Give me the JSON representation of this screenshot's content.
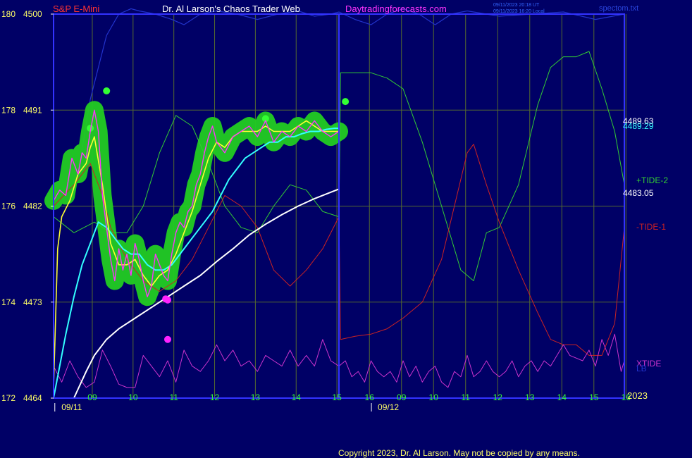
{
  "header": {
    "instrument": "S&P E-Mini",
    "author": "Dr. Al Larson's Chaos Trader Web",
    "site": "Daytradingforecasts.com",
    "stamp_line1": "09/11/2023 20:18 UT",
    "stamp_line2": "09/11/2023 16:20 Local",
    "file": "spectom.txt"
  },
  "footer": {
    "copyright": "Copyright 2023, Dr. Al Larson. May not be copied by any means.",
    "year": "2023"
  },
  "colors": {
    "background": "#000066",
    "frame": "#3333ff",
    "grid": "#556b2f",
    "price": "#ff33ff",
    "fast_ma": "#ffff33",
    "medium_ma": "#33ffff",
    "slow_ma": "#ffffff",
    "tide_plus2": "#33cc33",
    "tide_minus1": "#cc2222",
    "xtide": "#cc33cc",
    "blue_line": "#2233cc",
    "halo": "#22cc22",
    "halo_dot": "#33ff33",
    "dot": "#ff22ff"
  },
  "chart_data": {
    "type": "line",
    "y_axis_left": {
      "ticks": [
        {
          "outer": "172",
          "inner": "4464",
          "value": 4464
        },
        {
          "outer": "174",
          "inner": "4473",
          "value": 4473
        },
        {
          "outer": "176",
          "inner": "4482",
          "value": 4482
        },
        {
          "outer": "178",
          "inner": "4491",
          "value": 4491
        },
        {
          "outer": "180",
          "inner": "4500",
          "value": 4500
        }
      ],
      "ylim": [
        4464,
        4500
      ]
    },
    "x_axis": {
      "hours": [
        "09",
        "10",
        "11",
        "12",
        "13",
        "14",
        "15",
        "16",
        "09",
        "10",
        "11",
        "12",
        "13",
        "14",
        "15",
        "16"
      ],
      "dates": [
        {
          "label": "09/11",
          "after_hour_index": 0
        },
        {
          "label": "09/12",
          "after_hour_index": 8
        }
      ]
    },
    "right_labels": {
      "values": [
        {
          "text": "4489.63",
          "value": 4489.63,
          "color": "#ffffff"
        },
        {
          "text": "4489.29",
          "value": 4489.29,
          "color": "#33ffff"
        },
        {
          "text": "4483.05",
          "value": 4483.05,
          "color": "#ffffff"
        }
      ],
      "series": [
        {
          "text": "+TIDE-2",
          "color": "#33cc33"
        },
        {
          "text": "-TIDE-1",
          "color": "#cc2222"
        },
        {
          "text": "XTIDE",
          "color": "#cc33cc"
        },
        {
          "text": "LB",
          "color": "#2233cc"
        }
      ]
    },
    "series": [
      {
        "key": "price",
        "x": [
          0,
          0.15,
          0.3,
          0.45,
          0.6,
          0.7,
          0.8,
          0.9,
          1.0,
          1.1,
          1.2,
          1.3,
          1.4,
          1.5,
          1.6,
          1.7,
          1.8,
          1.9,
          2.0,
          2.1,
          2.2,
          2.3,
          2.4,
          2.5,
          2.6,
          2.7,
          2.8,
          2.9,
          3.0,
          3.1,
          3.2,
          3.3,
          3.4,
          3.5,
          3.6,
          3.7,
          3.8,
          3.9,
          4.0,
          4.2,
          4.4,
          4.6,
          4.8,
          5.0,
          5.2,
          5.4,
          5.6,
          5.8,
          6.0,
          6.2,
          6.4,
          6.6,
          6.8,
          7.0
        ],
        "y": [
          4482.5,
          4483.5,
          4483,
          4486.5,
          4485,
          4487,
          4486.5,
          4489,
          4491,
          4489,
          4483,
          4480,
          4477,
          4475,
          4478,
          4476,
          4477.5,
          4475.5,
          4478.5,
          4477,
          4475,
          4473.5,
          4474.5,
          4477.5,
          4476.5,
          4475.5,
          4475,
          4477.5,
          4479.5,
          4480.5,
          4480,
          4481.5,
          4482,
          4484,
          4485,
          4487,
          4488.5,
          4489.5,
          4488,
          4487,
          4488.5,
          4489,
          4489.5,
          4488.5,
          4490,
          4488,
          4489,
          4488.5,
          4489.5,
          4489,
          4490,
          4489,
          4488.5,
          4489
        ]
      },
      {
        "key": "fast_ma",
        "x": [
          0,
          0.1,
          0.2,
          0.4,
          0.6,
          0.8,
          0.9,
          1.0,
          1.2,
          1.4,
          1.6,
          1.8,
          2.0,
          2.2,
          2.4,
          2.6,
          2.8,
          3.0,
          3.2,
          3.4,
          3.6,
          3.8,
          4.0,
          4.2,
          4.4,
          4.6,
          4.8,
          5.0,
          5.2,
          5.4,
          5.6,
          5.8,
          6.0,
          6.2,
          6.4,
          6.6,
          6.8,
          7.0
        ],
        "y": [
          4465,
          4478,
          4481,
          4482.5,
          4485,
          4486,
          4487.5,
          4488.5,
          4484,
          4478.5,
          4476.5,
          4476.5,
          4477,
          4475.5,
          4474.5,
          4475.5,
          4476,
          4477.5,
          4479.5,
          4481.5,
          4484,
          4486.5,
          4488,
          4487.5,
          4488.5,
          4489,
          4489,
          4489,
          4489.5,
          4489,
          4489,
          4489,
          4489.5,
          4490,
          4489.5,
          4489,
          4489,
          4489
        ]
      },
      {
        "key": "medium_ma",
        "x": [
          0,
          0.15,
          0.3,
          0.5,
          0.7,
          0.9,
          1.1,
          1.3,
          1.5,
          1.7,
          1.9,
          2.1,
          2.3,
          2.5,
          2.7,
          2.9,
          3.1,
          3.3,
          3.5,
          3.7,
          3.9,
          4.1,
          4.3,
          4.5,
          4.7,
          4.9,
          5.1,
          5.3,
          5.5,
          5.7,
          5.9,
          6.1,
          6.3,
          6.5,
          6.7,
          6.9,
          7.0
        ],
        "y": [
          4464,
          4467,
          4470,
          4473.5,
          4476.5,
          4478.5,
          4480.5,
          4480,
          4479,
          4478,
          4477.5,
          4477.5,
          4476.5,
          4476,
          4476,
          4476.5,
          4477.5,
          4478.5,
          4479.5,
          4480.5,
          4481.5,
          4483,
          4484.5,
          4485.5,
          4486.5,
          4487,
          4487.5,
          4488,
          4488,
          4488.5,
          4488.5,
          4488.8,
          4489,
          4489,
          4489.2,
          4489.3,
          4489.29
        ]
      },
      {
        "key": "slow_ma",
        "x": [
          0.5,
          0.8,
          1.0,
          1.3,
          1.6,
          2.0,
          2.4,
          2.8,
          3.2,
          3.6,
          4.0,
          4.4,
          4.8,
          5.2,
          5.6,
          6.0,
          6.4,
          6.8,
          7.0
        ],
        "y": [
          4464,
          4466.5,
          4468,
          4469.5,
          4470.5,
          4471.5,
          4472.5,
          4473.5,
          4474.5,
          4475.5,
          4476.8,
          4478,
          4479.3,
          4480.3,
          4481.2,
          4482,
          4482.7,
          4483.3,
          4483.6
        ]
      },
      {
        "key": "tide_plus2",
        "x": [
          0,
          0.5,
          1.0,
          1.4,
          1.8,
          2.2,
          2.6,
          3.0,
          3.4,
          3.8,
          4.2,
          4.6,
          5.0,
          5.4,
          5.8,
          6.2,
          6.6,
          7.0,
          7.05,
          7.3,
          7.6,
          8.0,
          8.5,
          9.0,
          9.6,
          10.2,
          10.8,
          11.2,
          11.6,
          12.0,
          12.6,
          13.2,
          13.6,
          14.0,
          14.4,
          14.8,
          15.2,
          15.6,
          15.9
        ],
        "y": [
          4481,
          4479.5,
          4480.5,
          4479.5,
          4479.5,
          4482,
          4487,
          4490.5,
          4489.5,
          4486,
          4482,
          4480,
          4479.5,
          4482,
          4484,
          4483.5,
          4481.5,
          4481,
          4494.5,
          4494.5,
          4494.5,
          4494.5,
          4494,
          4493,
          4488,
          4482,
          4476,
          4475,
          4479.5,
          4480,
          4484,
          4491.5,
          4495,
          4496,
          4496,
          4496.5,
          4493,
          4489,
          4484
        ]
      },
      {
        "key": "tide_minus1",
        "x": [
          0,
          0.5,
          0.9,
          1.2,
          1.4,
          1.8,
          2.2,
          2.6,
          3.0,
          3.4,
          3.8,
          4.2,
          4.6,
          5.0,
          5.4,
          5.8,
          6.2,
          6.6,
          7.0,
          7.05,
          7.5,
          8.0,
          8.5,
          9.0,
          9.6,
          10.2,
          10.6,
          11.0,
          11.2,
          11.6,
          12.0,
          12.6,
          13.2,
          13.6,
          14.0,
          14.4,
          14.8,
          15.2,
          15.6,
          15.9
        ],
        "y": [
          4482,
          4484,
          4486,
          4483,
          4480,
          4477,
          4475,
          4474,
          4475,
          4477,
          4480,
          4483,
          4482,
          4480,
          4476,
          4474.5,
          4476,
          4478,
          4481,
          4469.5,
          4469.8,
          4470,
          4470.5,
          4471.5,
          4473,
          4477,
          4482,
          4487,
          4487.8,
          4484,
          4480.5,
          4476,
          4472,
          4469.5,
          4469,
          4469,
          4468,
          4468,
          4471,
          4480
        ]
      },
      {
        "key": "xtide",
        "x": [
          0,
          0.2,
          0.4,
          0.6,
          0.8,
          1.0,
          1.2,
          1.4,
          1.6,
          1.8,
          2.0,
          2.2,
          2.4,
          2.6,
          2.8,
          3.0,
          3.2,
          3.4,
          3.6,
          3.8,
          4.0,
          4.2,
          4.4,
          4.6,
          4.8,
          5.0,
          5.2,
          5.4,
          5.6,
          5.8,
          6.0,
          6.2,
          6.4,
          6.6,
          6.8,
          7.0,
          7.2,
          7.4,
          7.6,
          7.8,
          8.0,
          8.2,
          8.4,
          8.6,
          8.8,
          9.0,
          9.2,
          9.4,
          9.6,
          9.8,
          10.0,
          10.2,
          10.4,
          10.6,
          10.8,
          11.0,
          11.2,
          11.4,
          11.6,
          11.8,
          12.0,
          12.2,
          12.4,
          12.6,
          12.8,
          13.0,
          13.2,
          13.4,
          13.6,
          13.8,
          14.0,
          14.2,
          14.6,
          14.8,
          15.0,
          15.2,
          15.4,
          15.6,
          15.8,
          15.9
        ],
        "y": [
          4467,
          4465.5,
          4467.5,
          4466,
          4465,
          4465.5,
          4468.5,
          4467,
          4465.3,
          4465,
          4465,
          4468,
          4467,
          4466,
          4467.5,
          4465.5,
          4468.5,
          4467,
          4466.5,
          4467.5,
          4469,
          4467.5,
          4468.5,
          4467,
          4467.5,
          4466.5,
          4468,
          4467.5,
          4467,
          4468.5,
          4467,
          4468,
          4467,
          4469.5,
          4467.5,
          4467,
          4467.5,
          4466,
          4466.5,
          4465.5,
          4467.5,
          4466.5,
          4466,
          4466.5,
          4465.5,
          4467.5,
          4466,
          4467,
          4465.5,
          4466.5,
          4467,
          4465.5,
          4465,
          4466.5,
          4466,
          4468,
          4466,
          4466.5,
          4467.5,
          4466.5,
          4466,
          4466.5,
          4467.5,
          4466,
          4467,
          4467.5,
          4466.5,
          4467.5,
          4467,
          4468,
          4469,
          4468,
          4467.5,
          4468.5,
          4467,
          4469.5,
          4468,
          4470,
          4466.5,
          4467.5
        ]
      },
      {
        "key": "blue_line",
        "x": [
          0.6,
          0.9,
          1.1,
          1.3,
          1.6,
          1.9,
          2.1,
          2.5,
          2.9,
          3.2,
          3.6,
          4.0,
          4.5,
          5.0,
          5.5,
          6.0,
          6.4,
          6.8,
          7.0,
          7.5,
          8.0,
          8.5,
          9.0,
          9.5,
          10.0,
          10.5,
          11.0,
          12.0,
          13.0,
          14.0,
          15.0,
          15.9
        ],
        "y": [
          4485,
          4492,
          4495,
          4498,
          4500,
          4500.5,
          4500.3,
          4500,
          4499.5,
          4499,
          4500,
          4500.3,
          4500,
          4499.5,
          4500,
          4500.3,
          4499.8,
          4500,
          4500.2,
          4499.5,
          4499,
          4500,
          4500.5,
          4500,
          4499,
          4500,
          4500.3,
          4499.8,
          4500,
          4500.2,
          4499.5,
          4500
        ]
      }
    ],
    "dots": [
      {
        "x": 2.75,
        "y": 4473.3
      },
      {
        "x": 2.8,
        "y": 4473.2
      },
      {
        "x": 2.8,
        "y": 4469.5
      }
    ],
    "halo_peaks": [
      {
        "x": 1.3,
        "y": 4492.8
      },
      {
        "x": 0.9,
        "y": 4489.3
      },
      {
        "x": 5.2,
        "y": 4490.2
      },
      {
        "x": 7.2,
        "y": 4491.8
      }
    ]
  }
}
